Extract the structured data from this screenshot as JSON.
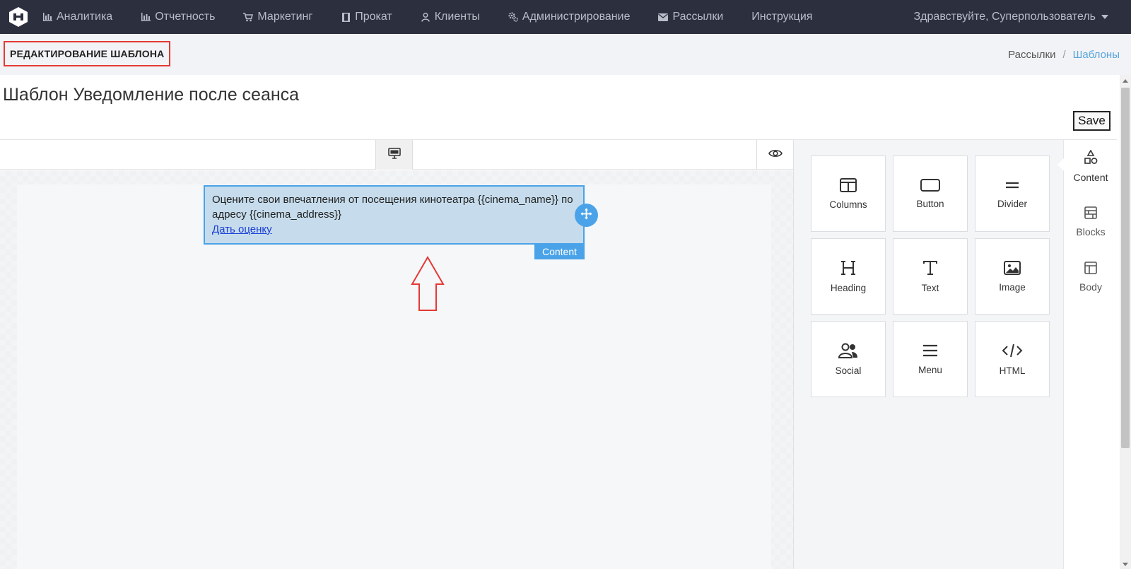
{
  "nav": {
    "items": [
      {
        "label": "Аналитика",
        "icon": "bar-chart-icon"
      },
      {
        "label": "Отчетность",
        "icon": "bar-chart-icon"
      },
      {
        "label": "Маркетинг",
        "icon": "cart-icon"
      },
      {
        "label": "Прокат",
        "icon": "film-icon"
      },
      {
        "label": "Клиенты",
        "icon": "user-icon"
      },
      {
        "label": "Администрирование",
        "icon": "gears-icon"
      },
      {
        "label": "Рассылки",
        "icon": "envelope-icon"
      },
      {
        "label": "Инструкция",
        "icon": ""
      }
    ],
    "user_greeting": "Здравствуйте, Суперпользователь"
  },
  "page": {
    "heading": "РЕДАКТИРОВАНИЕ ШАБЛОНА",
    "breadcrumb": [
      "Рассылки",
      "Шаблоны"
    ],
    "template_title": "Шаблон Уведомление после сеанса",
    "save_label": "Save"
  },
  "canvas": {
    "block_text": "Оцените свои впечатления от посещения кинотеатра {{cinema_name}} по адресу {{cinema_address}}",
    "block_link": "Дать оценку",
    "block_tag": "Content"
  },
  "tools": [
    {
      "label": "Columns",
      "icon": "columns-icon"
    },
    {
      "label": "Button",
      "icon": "button-icon"
    },
    {
      "label": "Divider",
      "icon": "divider-icon"
    },
    {
      "label": "Heading",
      "icon": "heading-icon"
    },
    {
      "label": "Text",
      "icon": "text-icon"
    },
    {
      "label": "Image",
      "icon": "image-icon"
    },
    {
      "label": "Social",
      "icon": "social-icon"
    },
    {
      "label": "Menu",
      "icon": "menu-icon"
    },
    {
      "label": "HTML",
      "icon": "code-icon"
    }
  ],
  "side_tabs": [
    {
      "label": "Content",
      "icon": "shapes-icon",
      "active": true
    },
    {
      "label": "Blocks",
      "icon": "blocks-icon",
      "active": false
    },
    {
      "label": "Body",
      "icon": "layout-icon",
      "active": false
    }
  ],
  "colors": {
    "nav_bg": "#2c2f3e",
    "accent": "#4aa3e8",
    "annotation_red": "#e53935",
    "breadcrumb_active": "#58a6dc"
  }
}
